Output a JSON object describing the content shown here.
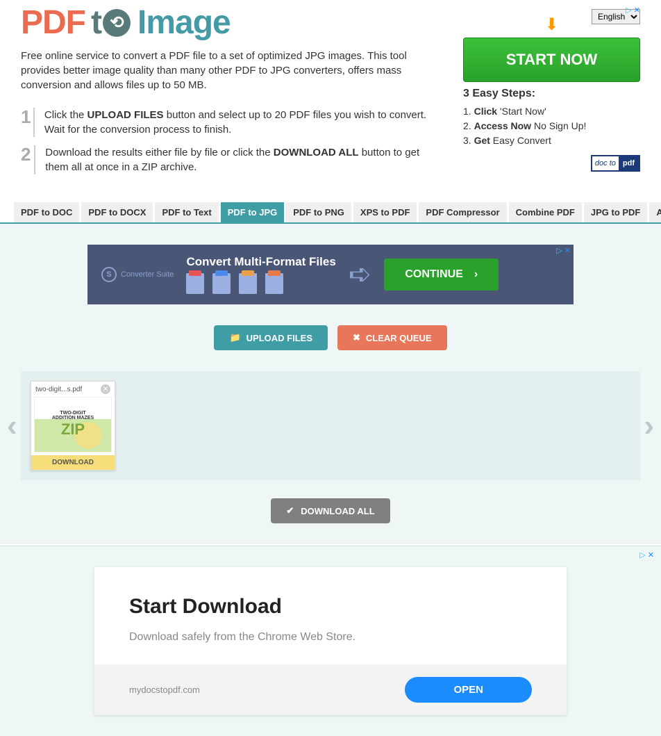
{
  "logo": {
    "pdf": "PDF",
    "to": "t",
    "image": "Image"
  },
  "language": {
    "selected": "English"
  },
  "description": "Free online service to convert a PDF file to a set of optimized JPG images. This tool provides better image quality than many other PDF to JPG converters, offers mass conversion and allows files up to 50 MB.",
  "steps": [
    {
      "num": "1",
      "text_pre": "Click the ",
      "bold1": "UPLOAD FILES",
      "text_post": " button and select up to 20 PDF files you wish to convert. Wait for the conversion process to finish."
    },
    {
      "num": "2",
      "text_pre": "Download the results either file by file or click the ",
      "bold1": "DOWNLOAD ALL",
      "text_post": " button to get them all at once in a ZIP archive."
    }
  ],
  "sidebar_ad": {
    "start_now": "START NOW",
    "heading": "3 Easy Steps:",
    "lines": [
      {
        "n": "1.",
        "b": "Click",
        "rest": " 'Start Now'"
      },
      {
        "n": "2.",
        "b": "Access Now",
        "rest": " No Sign Up!"
      },
      {
        "n": "3.",
        "b": "Get",
        "rest": " Easy Convert"
      }
    ],
    "badge_l": "doc to",
    "badge_r": "pdf"
  },
  "tabs": [
    "PDF to DOC",
    "PDF to DOCX",
    "PDF to Text",
    "PDF to JPG",
    "PDF to PNG",
    "XPS to PDF",
    "PDF Compressor",
    "Combine PDF",
    "JPG to PDF",
    "Any to PDF"
  ],
  "active_tab": 3,
  "banner_ad": {
    "brand": "Converter Suite",
    "title": "Convert Multi-Format Files",
    "cta": "CONTINUE"
  },
  "buttons": {
    "upload": "UPLOAD FILES",
    "clear": "CLEAR QUEUE",
    "download_all": "DOWNLOAD ALL"
  },
  "file": {
    "name": "two-digit...s.pdf",
    "thumb_line1": "TWO-DIGIT",
    "thumb_line2": "ADDITION MAZES",
    "thumb_zip": "ZIP",
    "download": "DOWNLOAD"
  },
  "bottom_ad": {
    "title": "Start Download",
    "sub": "Download safely from the Chrome Web Store.",
    "domain": "mydocstopdf.com",
    "cta": "OPEN"
  },
  "adchoice": "▷ ✕"
}
